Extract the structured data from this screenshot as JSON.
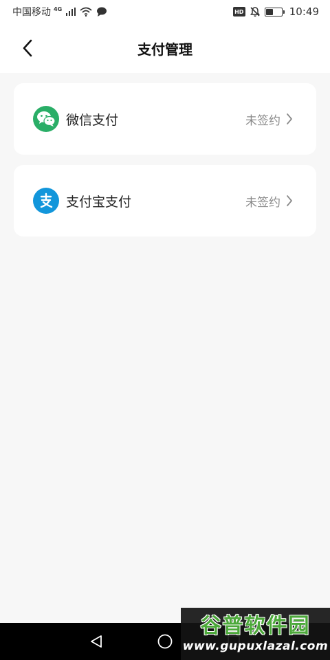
{
  "status_bar": {
    "carrier": "中国移动",
    "network": "4G",
    "hd_badge": "HD",
    "battery_level": 0.45,
    "time": "10:49"
  },
  "header": {
    "title": "支付管理"
  },
  "payments": [
    {
      "name": "微信支付",
      "status": "未签约",
      "icon": "wechat-icon",
      "color": "#2aae67"
    },
    {
      "name": "支付宝支付",
      "status": "未签约",
      "icon": "alipay-icon",
      "color": "#1296db"
    }
  ],
  "watermark": {
    "title": "谷普软件园",
    "url": "www.gupuxlazal.com"
  },
  "colors": {
    "background": "#f7f7f7",
    "card": "#ffffff",
    "secondary_text": "#8a8a8a"
  }
}
